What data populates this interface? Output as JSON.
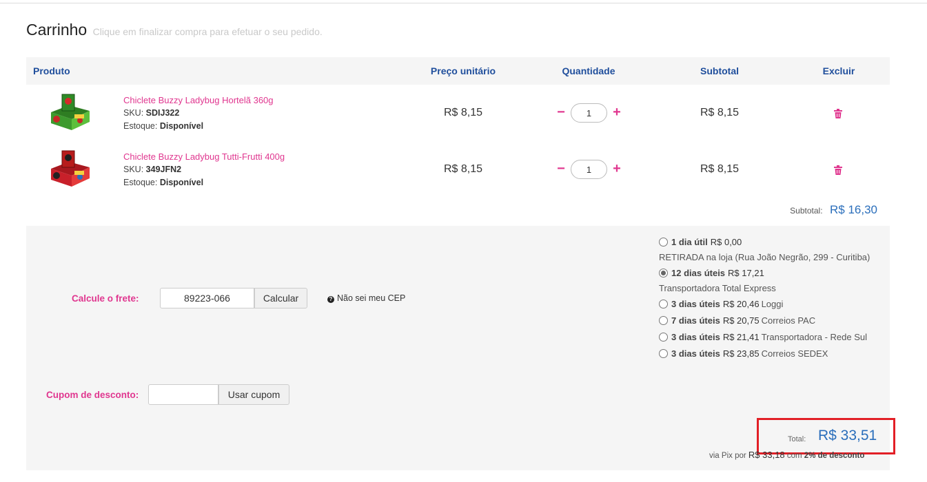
{
  "header": {
    "title": "Carrinho",
    "subtitle": "Clique em finalizar compra para efetuar o seu pedido."
  },
  "table": {
    "columns": [
      "Produto",
      "Preço unitário",
      "Quantidade",
      "Subtotal",
      "Excluir"
    ],
    "items": [
      {
        "name": "Chiclete Buzzy Ladybug Hortelã 360g",
        "sku_label": "SKU:",
        "sku": "SDIJ322",
        "stock_label": "Estoque:",
        "stock": "Disponível",
        "unit_price": "R$ 8,15",
        "quantity": "1",
        "subtotal": "R$ 8,15",
        "image_colors": [
          "#3d9a2e",
          "#7bd14a"
        ]
      },
      {
        "name": "Chiclete Buzzy Ladybug Tutti-Frutti 400g",
        "sku_label": "SKU:",
        "sku": "349JFN2",
        "stock_label": "Estoque:",
        "stock": "Disponível",
        "unit_price": "R$ 8,15",
        "quantity": "1",
        "subtotal": "R$ 8,15",
        "image_colors": [
          "#c8202a",
          "#f04848"
        ]
      }
    ],
    "qty_minus": "−",
    "qty_plus": "+",
    "delete_icon": "trash-icon"
  },
  "summary": {
    "subtotal_label": "Subtotal:",
    "subtotal_value": "R$ 16,30"
  },
  "shipping": {
    "calc_label": "Calcule o frete:",
    "cep_value": "89223-066",
    "calc_button": "Calcular",
    "help_text": "Não sei meu CEP",
    "options": [
      {
        "days": "1 dia útil",
        "price": "R$ 0,00",
        "carrier": "",
        "desc": "RETIRADA na loja (Rua João Negrão, 299 - Curitiba)",
        "selected": false
      },
      {
        "days": "12 dias úteis",
        "price": "R$ 17,21",
        "carrier": "",
        "desc": "Transportadora Total Express",
        "selected": true
      },
      {
        "days": "3 dias úteis",
        "price": "R$ 20,46",
        "carrier": "Loggi",
        "desc": "",
        "selected": false
      },
      {
        "days": "7 dias úteis",
        "price": "R$ 20,75",
        "carrier": "Correios PAC",
        "desc": "",
        "selected": false
      },
      {
        "days": "3 dias úteis",
        "price": "R$ 21,41",
        "carrier": "Transportadora - Rede Sul",
        "desc": "",
        "selected": false
      },
      {
        "days": "3 dias úteis",
        "price": "R$ 23,85",
        "carrier": "Correios SEDEX",
        "desc": "",
        "selected": false
      }
    ]
  },
  "coupon": {
    "label": "Cupom de desconto:",
    "value": "",
    "button": "Usar cupom"
  },
  "total": {
    "label": "Total:",
    "value": "R$ 33,51",
    "pix_prefix": "via Pix por",
    "pix_value": "R$ 33,18",
    "pix_with": "com",
    "pix_discount": "2% de desconto"
  },
  "colors": {
    "accent_pink": "#e0368f",
    "header_blue": "#1f4e9c",
    "price_blue": "#2a6ebb",
    "highlight_red": "#e21f26"
  }
}
